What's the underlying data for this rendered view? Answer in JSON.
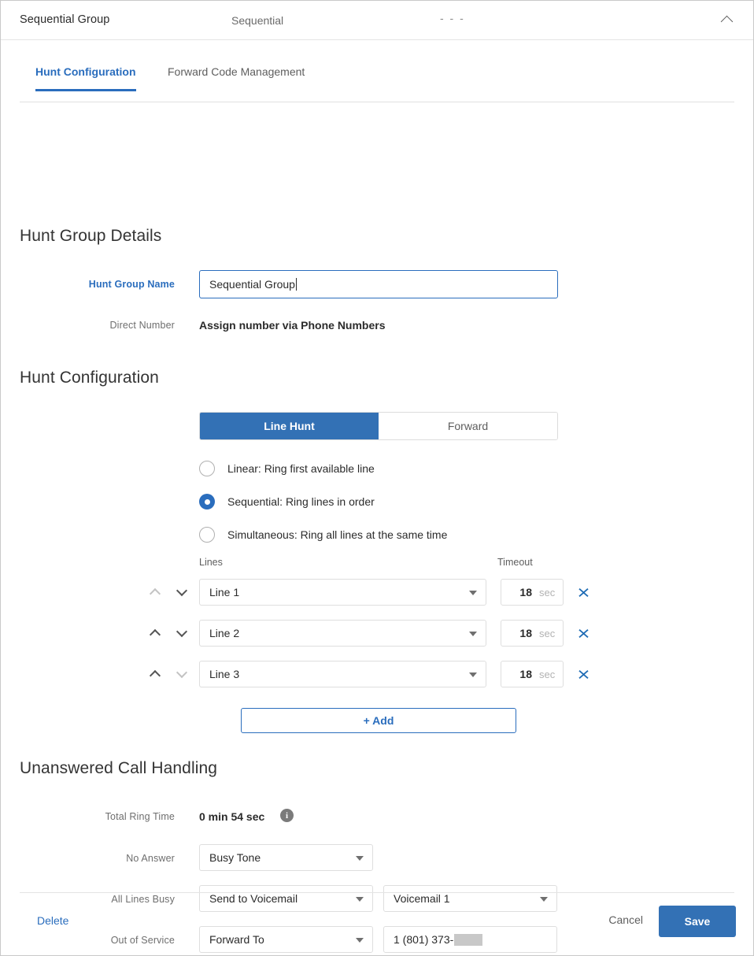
{
  "header": {
    "group_name": "Sequential Group",
    "hunt_type": "Sequential",
    "extra": "- - -",
    "collapse_icon": "chevron-up-icon"
  },
  "tabs": [
    {
      "label": "Hunt Configuration",
      "selected": true
    },
    {
      "label": "Forward Code Management",
      "selected": false
    }
  ],
  "hunt_group_details": {
    "section_title": "Hunt Group Details",
    "name_label": "Hunt Group Name",
    "name_value": "Sequential Group",
    "direct_number_label": "Direct Number",
    "direct_number_value": "Assign number via Phone Numbers"
  },
  "hunt_configuration": {
    "section_title": "Hunt Configuration",
    "mode_tabs": [
      {
        "label": "Line Hunt",
        "selected": true
      },
      {
        "label": "Forward",
        "selected": false
      }
    ],
    "options": [
      {
        "label": "Linear: Ring first available line",
        "selected": false
      },
      {
        "label": "Sequential: Ring lines in order",
        "selected": true
      },
      {
        "label": "Simultaneous: Ring all lines at the same time",
        "selected": false
      }
    ],
    "columns": {
      "lines": "Lines",
      "timeout": "Timeout"
    },
    "lines": [
      {
        "name": "Line 1",
        "timeout": "18",
        "unit": "sec",
        "up_enabled": false,
        "down_enabled": true
      },
      {
        "name": "Line 2",
        "timeout": "18",
        "unit": "sec",
        "up_enabled": true,
        "down_enabled": true
      },
      {
        "name": "Line 3",
        "timeout": "18",
        "unit": "sec",
        "up_enabled": true,
        "down_enabled": false
      }
    ],
    "remove_icon": "close-x-icon",
    "add_label": "+ Add"
  },
  "unanswered_call_handling": {
    "section_title": "Unanswered Call Handling",
    "total_ring_time_label": "Total Ring Time",
    "total_ring_time_value": "0 min 54 sec",
    "info_icon": "info-icon",
    "no_answer_label": "No Answer",
    "no_answer_value": "Busy Tone",
    "all_lines_busy_label": "All Lines Busy",
    "all_lines_busy_value": "Send to Voicemail",
    "all_lines_busy_target": "Voicemail 1",
    "out_of_service_label": "Out of Service",
    "out_of_service_value": "Forward To",
    "out_of_service_number": "1 (801) 373-"
  },
  "footer": {
    "delete_label": "Delete",
    "cancel_label": "Cancel",
    "save_label": "Save"
  },
  "colors": {
    "accent_blue": "#2a6dbd",
    "button_blue": "#3371b5",
    "text_dark": "#2b2b2b",
    "text_muted": "#6e6e6e",
    "border": "#dedede"
  }
}
